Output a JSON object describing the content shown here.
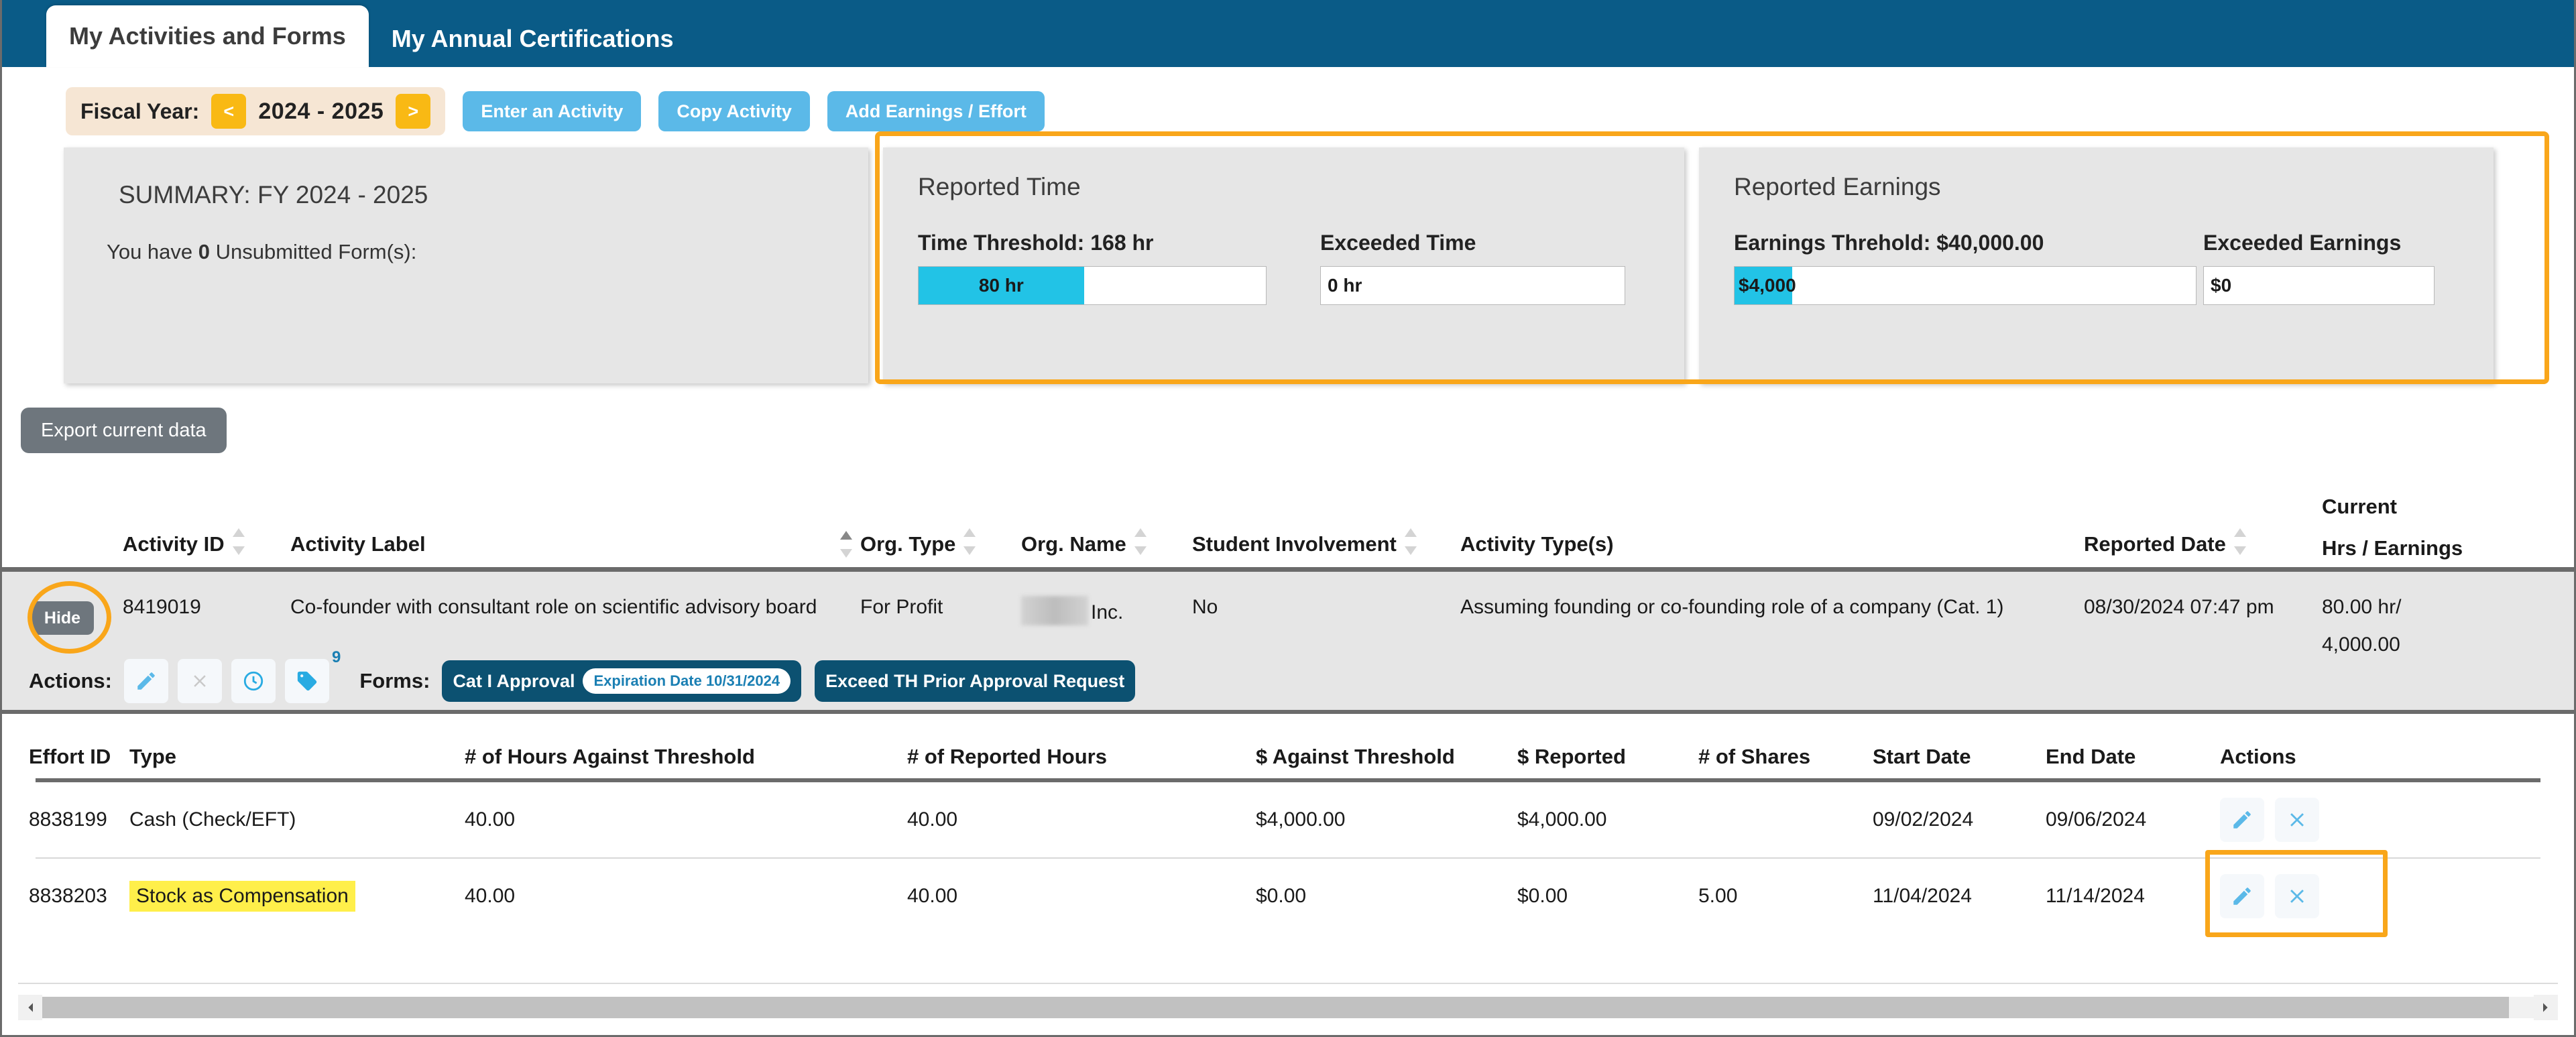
{
  "tabs": [
    {
      "label": "My Activities and Forms",
      "active": true
    },
    {
      "label": "My Annual Certifications",
      "active": false
    }
  ],
  "toolbar": {
    "fiscal_year_label": "Fiscal Year:",
    "prev_arrow": "<",
    "next_arrow": ">",
    "fiscal_year_value": "2024 - 2025",
    "enter_activity": "Enter an Activity",
    "copy_activity": "Copy Activity",
    "add_earnings": "Add Earnings / Effort"
  },
  "summary": {
    "title": "SUMMARY: FY 2024 - 2025",
    "line_prefix": "You have ",
    "count": "0",
    "line_suffix": " Unsubmitted Form(s):"
  },
  "reported_time": {
    "title": "Reported Time",
    "threshold_label": "Time Threshold: 168 hr",
    "bar_value": "80 hr",
    "bar_percent": 47.6,
    "exceeded_label": "Exceeded Time",
    "exceeded_value": "0 hr"
  },
  "reported_earnings": {
    "title": "Reported Earnings",
    "threshold_label": "Earnings Threhold: $40,000.00",
    "bar_value": "$4,000",
    "bar_percent": 10,
    "exceeded_label": "Exceeded Earnings",
    "exceeded_value": "$0"
  },
  "export_button": "Export current data",
  "activity_table": {
    "columns": [
      "Activity ID",
      "Activity Label",
      "Org. Type",
      "Org. Name",
      "Student Involvement",
      "Activity Type(s)",
      "Reported Date",
      "Current",
      "Hrs / Earnings"
    ],
    "row": {
      "hide_label": "Hide",
      "activity_id": "8419019",
      "activity_label": "Co-founder with consultant role on scientific advisory board",
      "org_type": "For Profit",
      "org_name_suffix": "Inc.",
      "student_involvement": "No",
      "activity_types": "Assuming founding or co-founding role of a company (Cat. 1)",
      "reported_date": "08/30/2024 07:47 pm",
      "current_hrs": "80.00 hr/",
      "current_earnings": "4,000.00"
    }
  },
  "actions_bar": {
    "actions_label": "Actions:",
    "edit_icon": "pencil-icon",
    "delete_icon": "x-icon",
    "history_icon": "clock-icon",
    "tag_icon": "tag-icon",
    "tag_count": "9",
    "forms_label": "Forms:",
    "form_primary": "Cat I Approval",
    "form_primary_pill": "Expiration Date 10/31/2024",
    "form_secondary": "Exceed TH Prior Approval Request"
  },
  "effort_table": {
    "columns": [
      "Effort ID",
      "Type",
      "# of Hours Against Threshold",
      "# of Reported Hours",
      "$ Against Threshold",
      "$ Reported",
      "# of Shares",
      "Start Date",
      "End Date",
      "Actions"
    ],
    "rows": [
      {
        "effort_id": "8838199",
        "type": "Cash (Check/EFT)",
        "type_highlighted": false,
        "hours_against_threshold": "40.00",
        "reported_hours": "40.00",
        "dollars_against_threshold": "$4,000.00",
        "dollars_reported": "$4,000.00",
        "shares": "",
        "start_date": "09/02/2024",
        "end_date": "09/06/2024",
        "actions_highlighted": false
      },
      {
        "effort_id": "8838203",
        "type": "Stock as Compensation",
        "type_highlighted": true,
        "hours_against_threshold": "40.00",
        "reported_hours": "40.00",
        "dollars_against_threshold": "$0.00",
        "dollars_reported": "$0.00",
        "shares": "5.00",
        "start_date": "11/04/2024",
        "end_date": "11/14/2024",
        "actions_highlighted": true
      }
    ]
  },
  "colors": {
    "tab_bar": "#0a5b87",
    "accent_blue": "#5bb9e8",
    "highlight_orange": "#f9a61a",
    "bar_cyan": "#22c3e6",
    "yellow_highlight": "#ffef4a",
    "panel_gray": "#e6e6e6",
    "form_dark_blue": "#0c5171"
  }
}
